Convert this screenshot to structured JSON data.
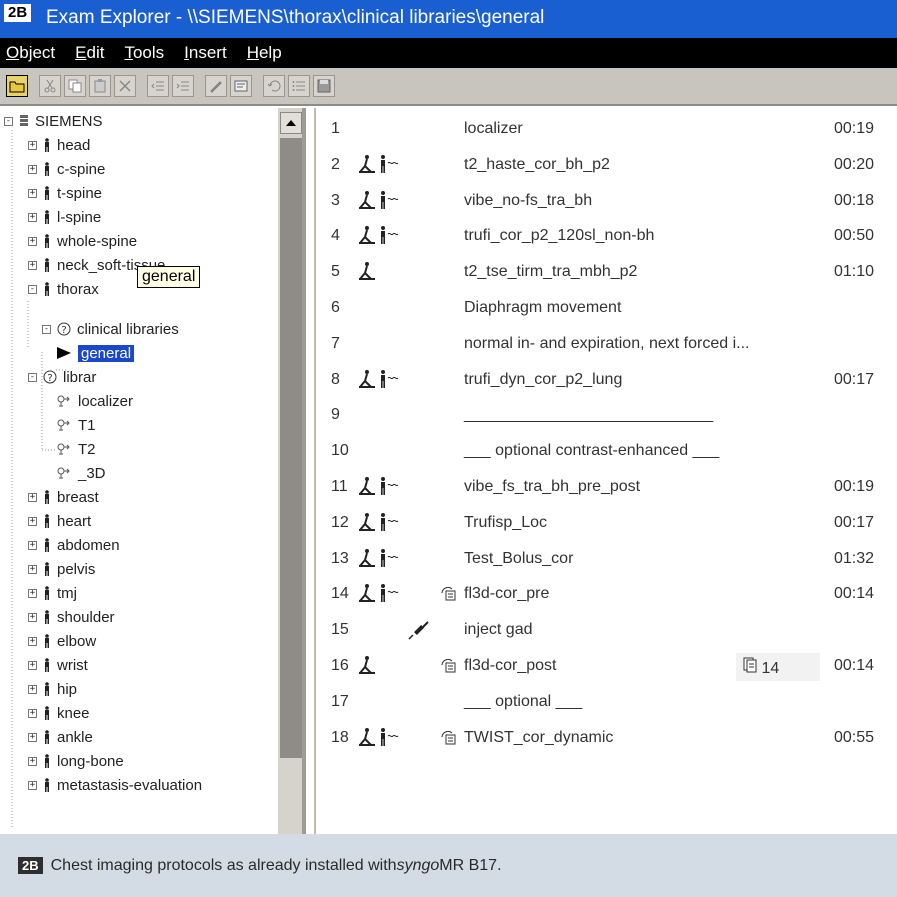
{
  "figure_label": "2B",
  "window": {
    "title": "Exam Explorer - \\\\SIEMENS\\thorax\\clinical libraries\\general"
  },
  "menu": [
    {
      "label": "Object",
      "key": "O",
      "rest": "bject"
    },
    {
      "label": "Edit",
      "key": "E",
      "rest": "dit"
    },
    {
      "label": "Tools",
      "key": "T",
      "rest": "ools"
    },
    {
      "label": "Insert",
      "key": "I",
      "rest": "nsert"
    },
    {
      "label": "Help",
      "key": "H",
      "rest": "elp"
    }
  ],
  "tree": {
    "root": "SIEMENS",
    "items": [
      {
        "label": "head"
      },
      {
        "label": "c-spine"
      },
      {
        "label": "t-spine"
      },
      {
        "label": "l-spine"
      },
      {
        "label": "whole-spine"
      },
      {
        "label": "neck_soft-tissue"
      },
      {
        "label": "thorax"
      }
    ],
    "thorax_children": {
      "clinical_libraries": "clinical libraries",
      "general": "general",
      "libraries_partial": "librar",
      "library_items": [
        "localizer",
        "T1",
        "T2",
        "_3D"
      ]
    },
    "items_after": [
      {
        "label": "breast"
      },
      {
        "label": "heart"
      },
      {
        "label": "abdomen"
      },
      {
        "label": "pelvis"
      },
      {
        "label": "tmj"
      },
      {
        "label": "shoulder"
      },
      {
        "label": "elbow"
      },
      {
        "label": "wrist"
      },
      {
        "label": "hip"
      },
      {
        "label": "knee"
      },
      {
        "label": "ankle"
      },
      {
        "label": "long-bone"
      },
      {
        "label": "metastasis-evaluation"
      }
    ],
    "tooltip": "general"
  },
  "protocols": [
    {
      "num": "1",
      "name": "localizer",
      "time": "00:19",
      "icons": []
    },
    {
      "num": "2",
      "name": "t2_haste_cor_bh_p2",
      "time": "00:20",
      "icons": [
        "patient-table-icon",
        "person-breath-icon"
      ]
    },
    {
      "num": "3",
      "name": "vibe_no-fs_tra_bh",
      "time": "00:18",
      "icons": [
        "patient-table-icon",
        "person-breath-icon"
      ]
    },
    {
      "num": "4",
      "name": "trufi_cor_p2_120sl_non-bh",
      "time": "00:50",
      "icons": [
        "patient-table-icon",
        "person-breath-icon"
      ]
    },
    {
      "num": "5",
      "name": "t2_tse_tirm_tra_mbh_p2",
      "time": "01:10",
      "icons": [
        "patient-table-icon"
      ]
    },
    {
      "num": "6",
      "name": "Diaphragm movement",
      "time": "",
      "icons": []
    },
    {
      "num": "7",
      "name": "normal in- and expiration, next forced i...",
      "time": "",
      "icons": []
    },
    {
      "num": "8",
      "name": "trufi_dyn_cor_p2_lung",
      "time": "00:17",
      "icons": [
        "patient-table-icon",
        "person-breath-icon"
      ]
    },
    {
      "num": "9",
      "name": "____________________________",
      "time": "",
      "icons": []
    },
    {
      "num": "10",
      "name": "___  optional  contrast-enhanced  ___",
      "time": "",
      "icons": []
    },
    {
      "num": "11",
      "name": "vibe_fs_tra_bh_pre_post",
      "time": "00:19",
      "icons": [
        "patient-table-icon",
        "person-breath-icon"
      ]
    },
    {
      "num": "12",
      "name": "Trufisp_Loc",
      "time": "00:17",
      "icons": [
        "patient-table-icon",
        "person-breath-icon"
      ]
    },
    {
      "num": "13",
      "name": "Test_Bolus_cor",
      "time": "01:32",
      "icons": [
        "patient-table-icon",
        "person-breath-icon"
      ]
    },
    {
      "num": "14",
      "name": "fl3d-cor_pre",
      "time": "00:14",
      "icons": [
        "patient-table-icon",
        "person-breath-icon"
      ],
      "aux": "copy-reference-icon"
    },
    {
      "num": "15",
      "name": "inject gad",
      "time": "",
      "icons": [],
      "aux": "syringe-icon"
    },
    {
      "num": "16",
      "name": "fl3d-cor_post",
      "time": "00:14",
      "icons": [
        "patient-table-icon"
      ],
      "aux": "copy-reference-icon",
      "extra": "14"
    },
    {
      "num": "17",
      "name": "___  optional  ___",
      "time": "",
      "icons": []
    },
    {
      "num": "18",
      "name": "TWIST_cor_dynamic",
      "time": "00:55",
      "icons": [
        "patient-table-icon",
        "person-breath-icon"
      ],
      "aux": "copy-reference-icon"
    }
  ],
  "caption": {
    "badge": "2B",
    "text_before": "Chest imaging protocols as already installed with ",
    "italic": "syngo",
    "text_after": " MR B17."
  },
  "colors": {
    "title_bar": "#1a5fd1",
    "menu_bar": "#000000",
    "selection": "#1a48c8",
    "caption_bg": "#d3dce4"
  }
}
